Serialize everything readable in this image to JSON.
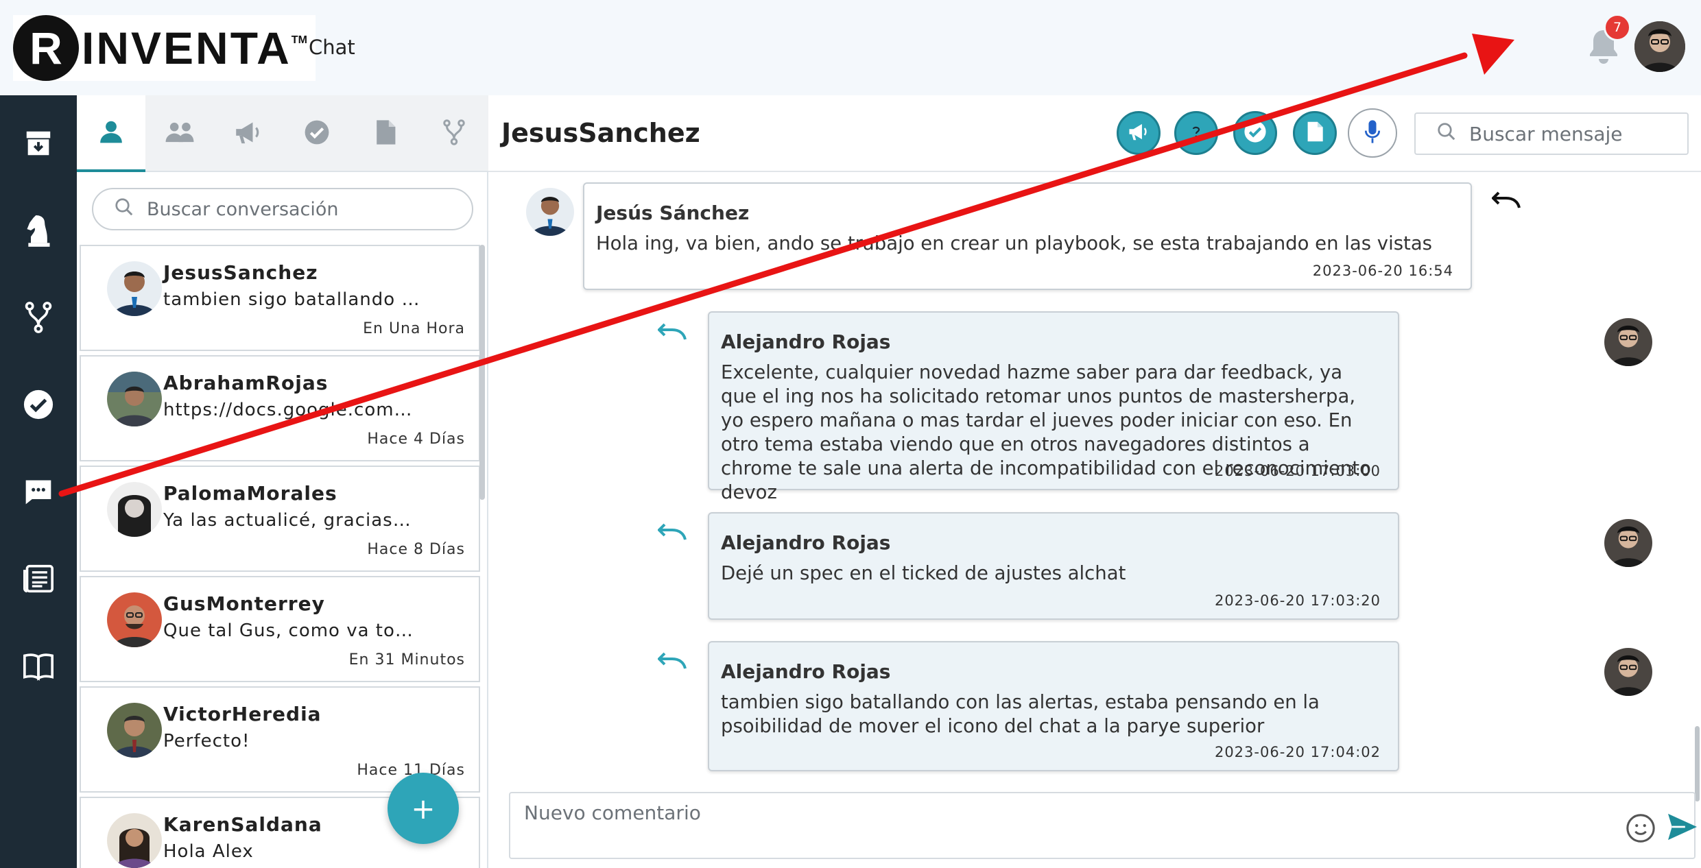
{
  "header": {
    "logo_text": "INVENTA",
    "logo_mark": "R",
    "logo_tm": "TM",
    "app_title": "Chat",
    "notification_count": "7"
  },
  "rail": {
    "items": [
      "inbox-icon",
      "chess-knight-icon",
      "branch-icon",
      "check-circle-icon",
      "chat-icon",
      "newspaper-icon",
      "book-icon"
    ],
    "active": "chat-icon"
  },
  "conversations": {
    "tabs": [
      "person-icon",
      "group-icon",
      "megaphone-icon",
      "check-circle-icon",
      "document-icon",
      "branch-icon"
    ],
    "search_placeholder": "Buscar conversación",
    "items": [
      {
        "name": "JesusSanchez",
        "preview": "tambien sigo batallando …",
        "time": "En Una Hora"
      },
      {
        "name": "AbrahamRojas",
        "preview": "https://docs.google.com…",
        "time": "Hace 4 Días"
      },
      {
        "name": "PalomaMorales",
        "preview": "Ya las actualicé, gracias…",
        "time": "Hace 8 Días"
      },
      {
        "name": "GusMonterrey",
        "preview": "Que tal Gus, como va to…",
        "time": "En 31 Minutos"
      },
      {
        "name": "VictorHeredia",
        "preview": "Perfecto!",
        "time": "Hace 11 Días"
      },
      {
        "name": "KarenSaldana",
        "preview": "Hola Alex",
        "time": ""
      }
    ],
    "fab_label": "+"
  },
  "chat": {
    "title": "JesusSanchez",
    "header_buttons": [
      "megaphone-icon",
      "question-icon",
      "check-circle-icon",
      "document-icon",
      "microphone-icon"
    ],
    "search_placeholder": "Buscar mensaje",
    "messages": [
      {
        "author": "Jesús Sánchez",
        "text": "Hola ing, va bien, ando se trabajo en crear un playbook, se esta trabajando en las vistas",
        "timestamp": "2023-06-20    16:54"
      },
      {
        "author": "Alejandro Rojas",
        "text": "Excelente, cualquier novedad hazme saber para dar feedback, ya que el ing nos ha solicitado retomar unos puntos de mastersherpa, yo espero mañana o mas tardar el jueves poder iniciar con eso. En otro tema estaba viendo que en otros navegadores distintos a chrome te sale una alerta de incompatibilidad con el reconocimiento devoz",
        "timestamp": "2023-06-20    17:03:00"
      },
      {
        "author": "Alejandro Rojas",
        "text": "Dejé un spec en el ticked de ajustes alchat",
        "timestamp": "2023-06-20    17:03:20"
      },
      {
        "author": "Alejandro Rojas",
        "text": "tambien sigo batallando con las alertas, estaba pensando en la psoibilidad de mover el icono del chat a la parye superior",
        "timestamp": "2023-06-20    17:04:02"
      }
    ],
    "composer_placeholder": "Nuevo comentario"
  },
  "colors": {
    "rail": "#1d2b36",
    "accent": "#2ea5b8",
    "annotation_arrow": "#e81414",
    "badge": "#e53935"
  }
}
